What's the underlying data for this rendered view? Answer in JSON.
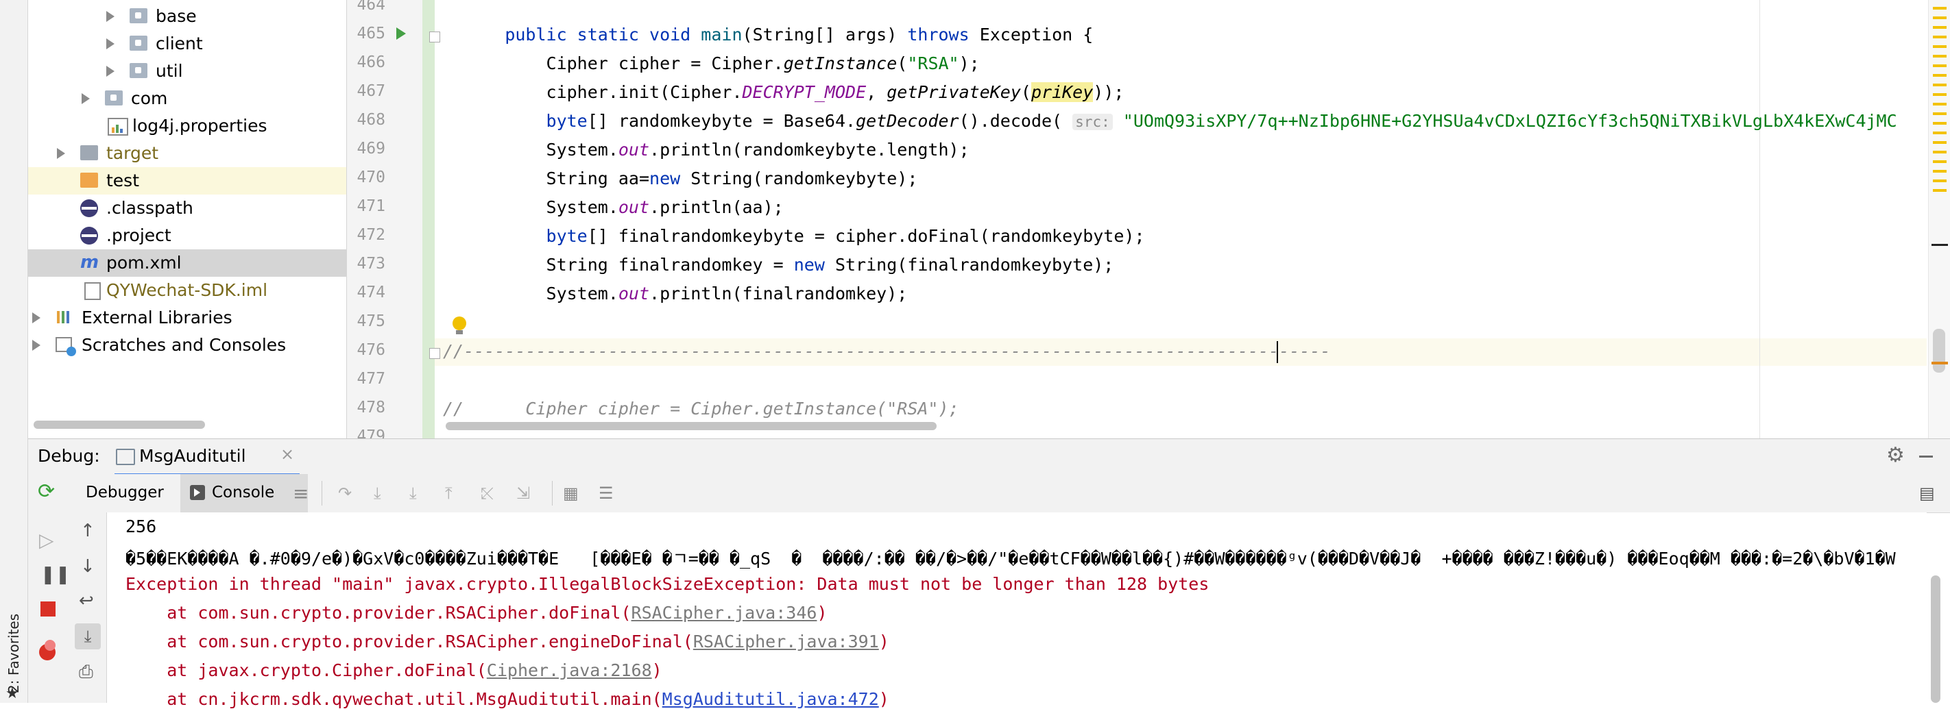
{
  "project_tree": {
    "items": [
      {
        "label": "base",
        "icon": "package-icon",
        "arrow": true
      },
      {
        "label": "client",
        "icon": "package-icon",
        "arrow": true
      },
      {
        "label": "util",
        "icon": "package-icon",
        "arrow": true
      },
      {
        "label": "com",
        "icon": "package-icon",
        "arrow": true
      },
      {
        "label": "log4j.properties",
        "icon": "properties-file-icon",
        "arrow": false
      },
      {
        "label": "target",
        "icon": "folder-icon",
        "arrow": true
      },
      {
        "label": "test",
        "icon": "folder-icon",
        "arrow": false
      },
      {
        "label": ".classpath",
        "icon": "eclipse-icon",
        "arrow": false
      },
      {
        "label": ".project",
        "icon": "eclipse-icon",
        "arrow": false
      },
      {
        "label": "pom.xml",
        "icon": "maven-icon",
        "arrow": false
      },
      {
        "label": "QYWechat-SDK.iml",
        "icon": "iml-file-icon",
        "arrow": false
      },
      {
        "label": "External Libraries",
        "icon": "libraries-icon",
        "arrow": true
      },
      {
        "label": "Scratches and Consoles",
        "icon": "scratches-icon",
        "arrow": true
      }
    ],
    "colors": {
      "selected_bg": "#d5d5d5",
      "highlight_bg": "#fbf8dc",
      "target_text": "#7a6a1d",
      "iml_text": "#7a6a1d"
    }
  },
  "editor": {
    "line_numbers": [
      "464",
      "465",
      "466",
      "467",
      "468",
      "469",
      "470",
      "471",
      "472",
      "473",
      "474",
      "475",
      "476",
      "477",
      "478",
      "479"
    ],
    "code": {
      "l465_kw1": "public static void ",
      "l465_main": "main",
      "l465_rest": "(String[] args) ",
      "l465_throws": "throws",
      "l465_end": " Exception {",
      "l466_a": "Cipher cipher = Cipher.",
      "l466_b": "getInstance",
      "l466_c": "(",
      "l466_str": "\"RSA\"",
      "l466_d": ");",
      "l467_a": "cipher.init(Cipher.",
      "l467_b": "DECRYPT_MODE",
      "l467_c": ", ",
      "l467_d": "getPrivateKey",
      "l467_e": "(",
      "l467_f": "priKey",
      "l467_g": "));",
      "l468_kw": "byte",
      "l468_a": "[] randomkeybyte = Base64.",
      "l468_b": "getDecoder",
      "l468_c": "().decode( ",
      "l468_hint": "src:",
      "l468_str": " \"UOmQ93isXPY/7q++NzIbp6HNE+G2YHSUa4vCDxLQZI6cYf3ch5QNiTXBikVLgLbX4kEXwC4jMC",
      "l469_a": "System.",
      "l469_b": "out",
      "l469_c": ".println(randomkeybyte.length);",
      "l470_a": "String aa=",
      "l470_kw": "new",
      "l470_b": " String(randomkeybyte);",
      "l471_a": "System.",
      "l471_b": "out",
      "l471_c": ".println(aa);",
      "l472_kw": "byte",
      "l472_a": "[] finalrandomkeybyte = cipher.doFinal(randomkeybyte);",
      "l473_a": "String finalrandomkey = ",
      "l473_kw": "new",
      "l473_b": " String(finalrandomkeybyte);",
      "l474_a": "System.",
      "l474_b": "out",
      "l474_c": ".println(finalrandomkey);",
      "l476": "//------------------------------------------------------------------------------------",
      "l478_a": "//",
      "l478_b": "      Cipher cipher = Cipher.getInstance(\"RSA\");"
    }
  },
  "debug": {
    "label": "Debug:",
    "tab_name": "MsgAuditutil",
    "tabs": [
      "Debugger",
      "Console"
    ],
    "active_tab": "Console"
  },
  "console": {
    "line1": "256",
    "line2": "�5��EK����A �.#0�9/e�)�GxV�c0����Zui���T�E   [���E� �ㄱ=�� �_qS  �  ����/:�� ��/�>��/\"�e��tCF��W��l��{)#��W������ᵍv(���D�V��J�  +���� ���Z!���u�) ���Eoq��M ���:�=2�\\�bV�1�W",
    "line3": "Exception in thread \"main\" javax.crypto.IllegalBlockSizeException: Data must not be longer than 128 bytes",
    "trace": [
      {
        "prefix": "    at com.sun.crypto.provider.RSACipher.doFinal(",
        "link": "RSACipher.java:346",
        "suffix": ")"
      },
      {
        "prefix": "    at com.sun.crypto.provider.RSACipher.engineDoFinal(",
        "link": "RSACipher.java:391",
        "suffix": ")"
      },
      {
        "prefix": "    at javax.crypto.Cipher.doFinal(",
        "link": "Cipher.java:2168",
        "suffix": ")"
      },
      {
        "prefix": "    at cn.jkcrm.sdk.qywechat.util.MsgAuditutil.main(",
        "link": "MsgAuditutil.java:472",
        "suffix": ")"
      }
    ]
  },
  "left_stripe": {
    "favorites_label": "2: Favorites"
  }
}
